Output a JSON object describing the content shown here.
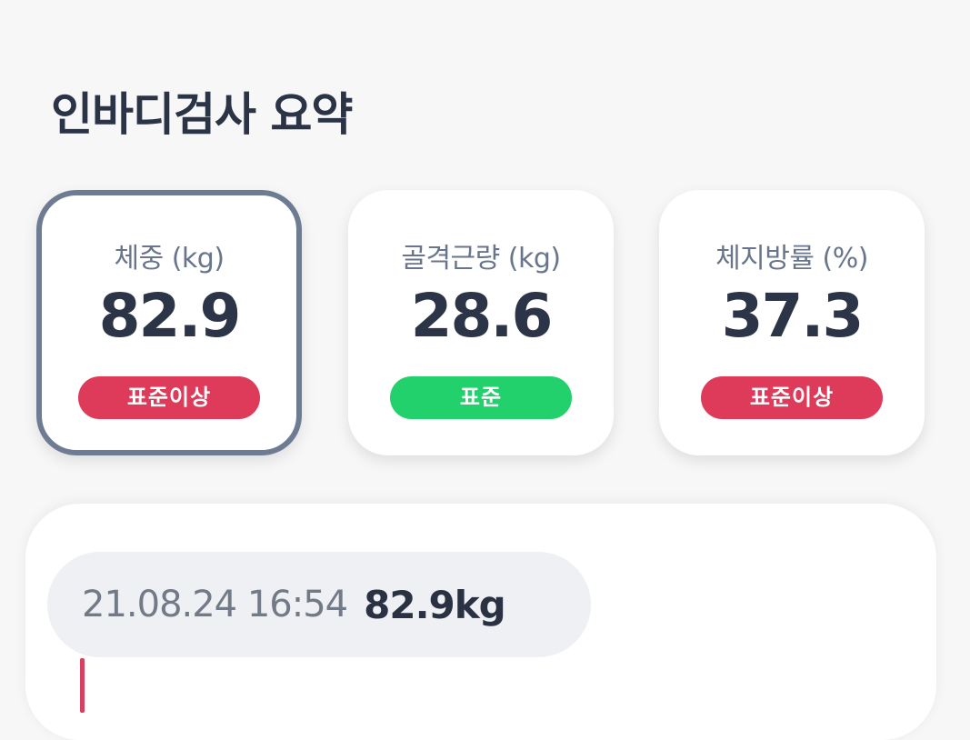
{
  "page": {
    "title": "인바디검사 요약"
  },
  "cards": [
    {
      "label": "체중 (kg)",
      "value": "82.9",
      "status": "표준이상",
      "status_color": "#de3a5a",
      "selected": true
    },
    {
      "label": "골격근량 (kg)",
      "value": "28.6",
      "status": "표준",
      "status_color": "#22d16c",
      "selected": false
    },
    {
      "label": "체지방률 (%)",
      "value": "37.3",
      "status": "표준이상",
      "status_color": "#de3a5a",
      "selected": false
    }
  ],
  "history": {
    "datetime": "21.08.24 16:54",
    "value": "82.9kg",
    "marker_color": "#d5415f"
  },
  "colors": {
    "background": "#f7f7f8",
    "card_border_selected": "#6e7c93",
    "text_primary": "#2c3447",
    "text_secondary": "#68758b"
  }
}
